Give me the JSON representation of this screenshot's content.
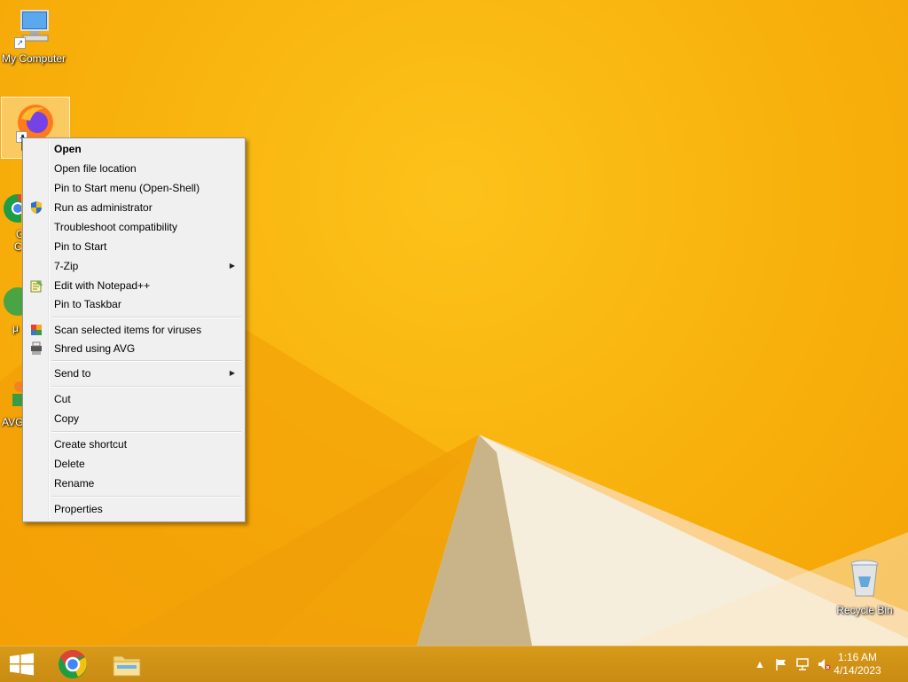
{
  "desktop": {
    "icons": [
      {
        "name": "My Computer",
        "icon": "computer-icon"
      },
      {
        "name": "",
        "icon": "firefox-icon"
      },
      {
        "name": "G",
        "name2": "C",
        "icon": "chrome-icon"
      },
      {
        "name": "μ",
        "icon": "utorrent-icon"
      },
      {
        "name": "AVG",
        "icon": "avg-icon"
      },
      {
        "name": "Recycle Bin",
        "icon": "recycle-bin-icon"
      }
    ]
  },
  "context_menu": {
    "items": [
      {
        "label": "Open",
        "bold": true
      },
      {
        "label": "Open file location"
      },
      {
        "label": "Pin to Start menu (Open-Shell)"
      },
      {
        "label": "Run as administrator",
        "icon": "shield-icon"
      },
      {
        "label": "Troubleshoot compatibility"
      },
      {
        "label": "Pin to Start"
      },
      {
        "label": "7-Zip",
        "submenu": true
      },
      {
        "label": "Edit with Notepad++",
        "icon": "notepadpp-icon"
      },
      {
        "label": "Pin to Taskbar"
      },
      {
        "label": "Scan selected items for viruses",
        "icon": "avg-icon"
      },
      {
        "label": "Shred using AVG",
        "icon": "shredder-icon"
      },
      {
        "label": "Send to",
        "submenu": true
      },
      {
        "label": "Cut"
      },
      {
        "label": "Copy"
      },
      {
        "label": "Create shortcut"
      },
      {
        "label": "Delete"
      },
      {
        "label": "Rename"
      },
      {
        "label": "Properties"
      }
    ]
  },
  "taskbar": {
    "pinned": [
      {
        "name": "start-button",
        "icon": "windows-logo-icon"
      },
      {
        "name": "chrome",
        "icon": "chrome-icon"
      },
      {
        "name": "file-explorer",
        "icon": "folder-icon"
      }
    ],
    "tray": {
      "icons": [
        "chevron-up-icon",
        "flag-icon",
        "network-icon",
        "volume-muted-icon"
      ],
      "time": "1:16 AM",
      "date": "4/14/2023"
    }
  },
  "colors": {
    "wallpaper": "#f7b20a",
    "taskbar": "#c98b12",
    "menu_bg": "#f0f0f0"
  }
}
